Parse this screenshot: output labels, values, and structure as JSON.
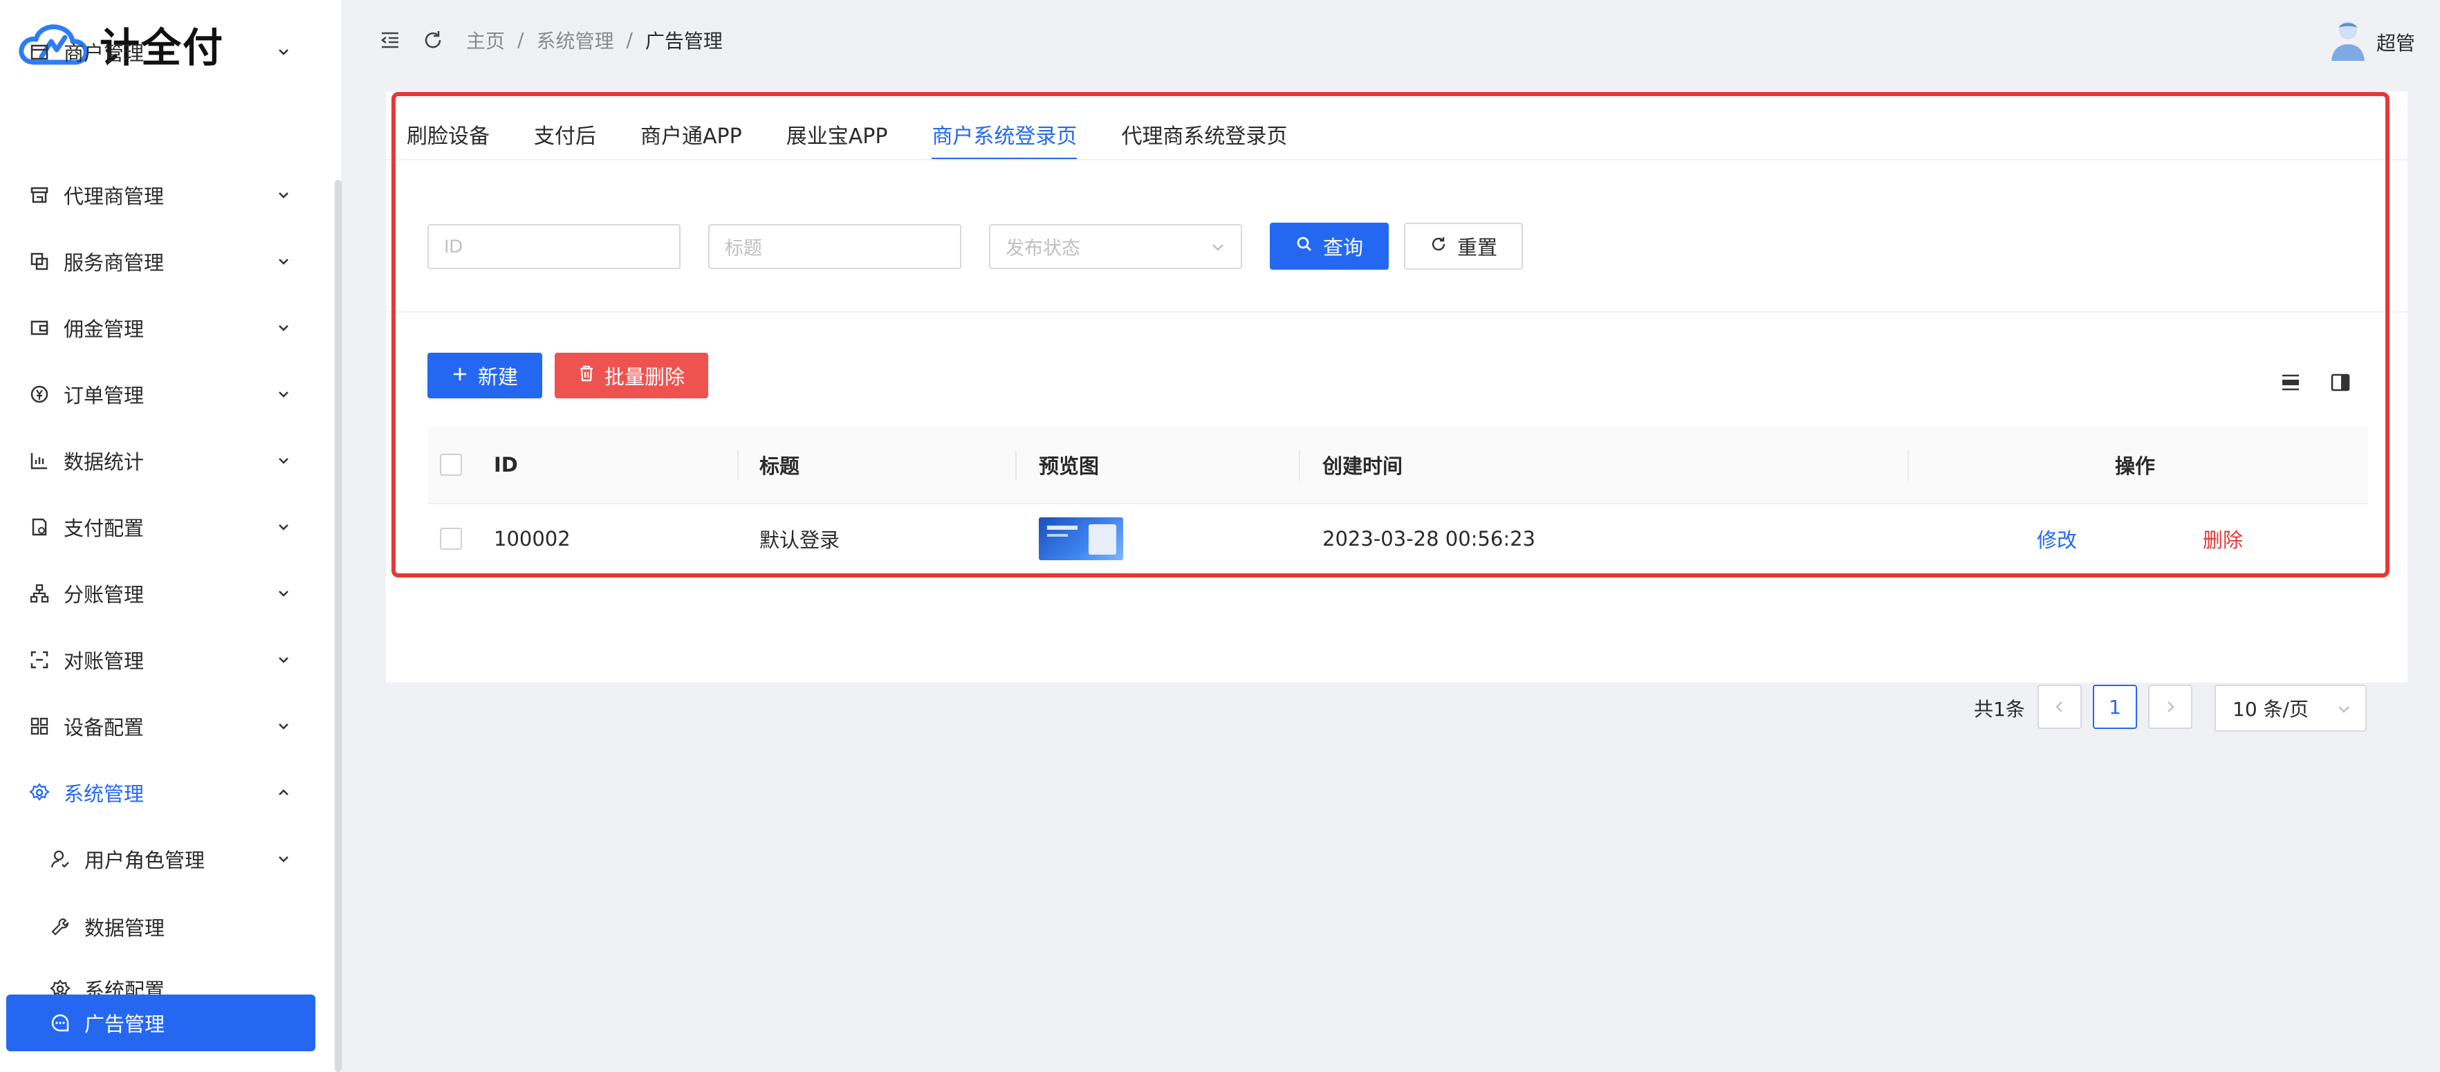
{
  "app": {
    "logo_text": "计全付"
  },
  "sidebar": {
    "items": [
      {
        "label": "商户管理",
        "icon": "store-icon"
      },
      {
        "label": "代理商管理",
        "icon": "shop-icon"
      },
      {
        "label": "服务商管理",
        "icon": "copy-icon"
      },
      {
        "label": "佣金管理",
        "icon": "wallet-icon"
      },
      {
        "label": "订单管理",
        "icon": "yuan-circle-icon"
      },
      {
        "label": "数据统计",
        "icon": "bar-chart-icon"
      },
      {
        "label": "支付配置",
        "icon": "file-settings-icon"
      },
      {
        "label": "分账管理",
        "icon": "org-tree-icon"
      },
      {
        "label": "对账管理",
        "icon": "reconcile-icon"
      },
      {
        "label": "设备配置",
        "icon": "grid-icon"
      },
      {
        "label": "系统管理",
        "icon": "gear-icon"
      }
    ],
    "sub_items": [
      {
        "label": "用户角色管理",
        "icon": "user-role-icon"
      },
      {
        "label": "数据管理",
        "icon": "wrench-icon"
      },
      {
        "label": "系统配置",
        "icon": "gear-icon"
      },
      {
        "label": "广告管理",
        "icon": "chat-bubble-icon"
      }
    ]
  },
  "header": {
    "breadcrumb": [
      "主页",
      "/",
      "系统管理",
      "/",
      "广告管理"
    ],
    "user_name": "超管"
  },
  "tabs": [
    "刷脸设备",
    "支付后",
    "商户通APP",
    "展业宝APP",
    "商户系统登录页",
    "代理商系统登录页"
  ],
  "active_tab": "商户系统登录页",
  "filters": {
    "id_placeholder": "ID",
    "title_placeholder": "标题",
    "status_placeholder": "发布状态",
    "query_label": "查询",
    "reset_label": "重置"
  },
  "toolbar": {
    "new_label": "新建",
    "batch_delete_label": "批量删除"
  },
  "table": {
    "columns": [
      "ID",
      "标题",
      "预览图",
      "创建时间",
      "操作"
    ],
    "rows": [
      {
        "id": "100002",
        "title": "默认登录",
        "created": "2023-03-28 00:56:23",
        "edit": "修改",
        "delete": "删除"
      }
    ]
  },
  "pagination": {
    "total_text": "共1条",
    "current_page": "1",
    "page_size": "10 条/页"
  },
  "colors": {
    "primary": "#2468f2",
    "danger": "#ef5350",
    "highlight_frame": "#e53935"
  }
}
